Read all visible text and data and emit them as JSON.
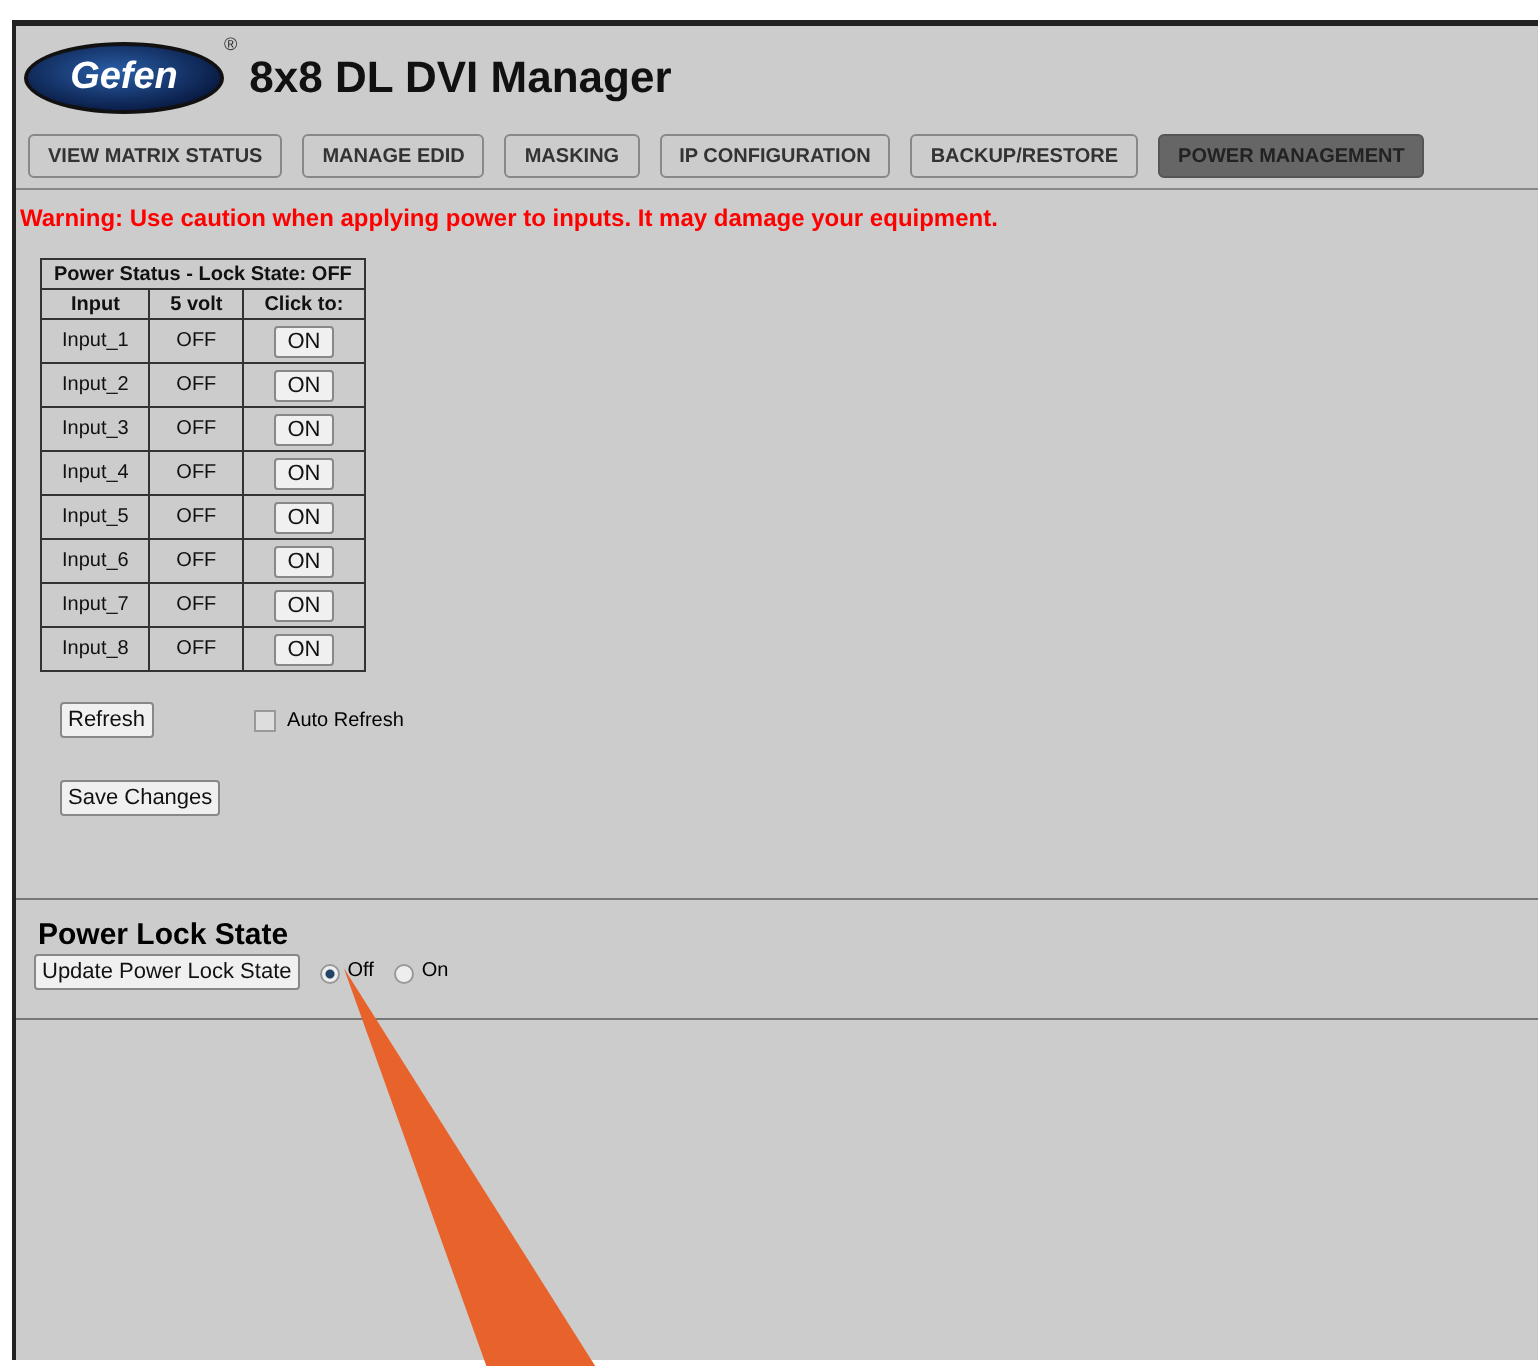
{
  "header": {
    "logo": "Gefen",
    "logo_mark": "®",
    "title": "8x8 DL DVI Manager"
  },
  "tabs": [
    {
      "label": "VIEW MATRIX STATUS",
      "selected": false
    },
    {
      "label": "MANAGE EDID",
      "selected": false
    },
    {
      "label": "MASKING",
      "selected": false
    },
    {
      "label": "IP CONFIGURATION",
      "selected": false
    },
    {
      "label": "BACKUP/RESTORE",
      "selected": false
    },
    {
      "label": "POWER MANAGEMENT",
      "selected": true
    }
  ],
  "warning": "Warning: Use caution when applying power to inputs. It may damage your equipment.",
  "power_table": {
    "caption": "Power Status - Lock State:  OFF",
    "columns": [
      "Input",
      "5 volt",
      "Click to:"
    ],
    "rows": [
      {
        "input": "Input_1",
        "volt": "OFF",
        "action": "ON"
      },
      {
        "input": "Input_2",
        "volt": "OFF",
        "action": "ON"
      },
      {
        "input": "Input_3",
        "volt": "OFF",
        "action": "ON"
      },
      {
        "input": "Input_4",
        "volt": "OFF",
        "action": "ON"
      },
      {
        "input": "Input_5",
        "volt": "OFF",
        "action": "ON"
      },
      {
        "input": "Input_6",
        "volt": "OFF",
        "action": "ON"
      },
      {
        "input": "Input_7",
        "volt": "OFF",
        "action": "ON"
      },
      {
        "input": "Input_8",
        "volt": "OFF",
        "action": "ON"
      }
    ]
  },
  "refresh_button": "Refresh",
  "auto_refresh": {
    "label": "Auto Refresh",
    "checked": false
  },
  "save_button": "Save Changes",
  "lock_section": {
    "heading": "Power Lock State",
    "button": "Update Power Lock State",
    "options": [
      {
        "label": "Off",
        "selected": true
      },
      {
        "label": "On",
        "selected": false
      }
    ]
  }
}
